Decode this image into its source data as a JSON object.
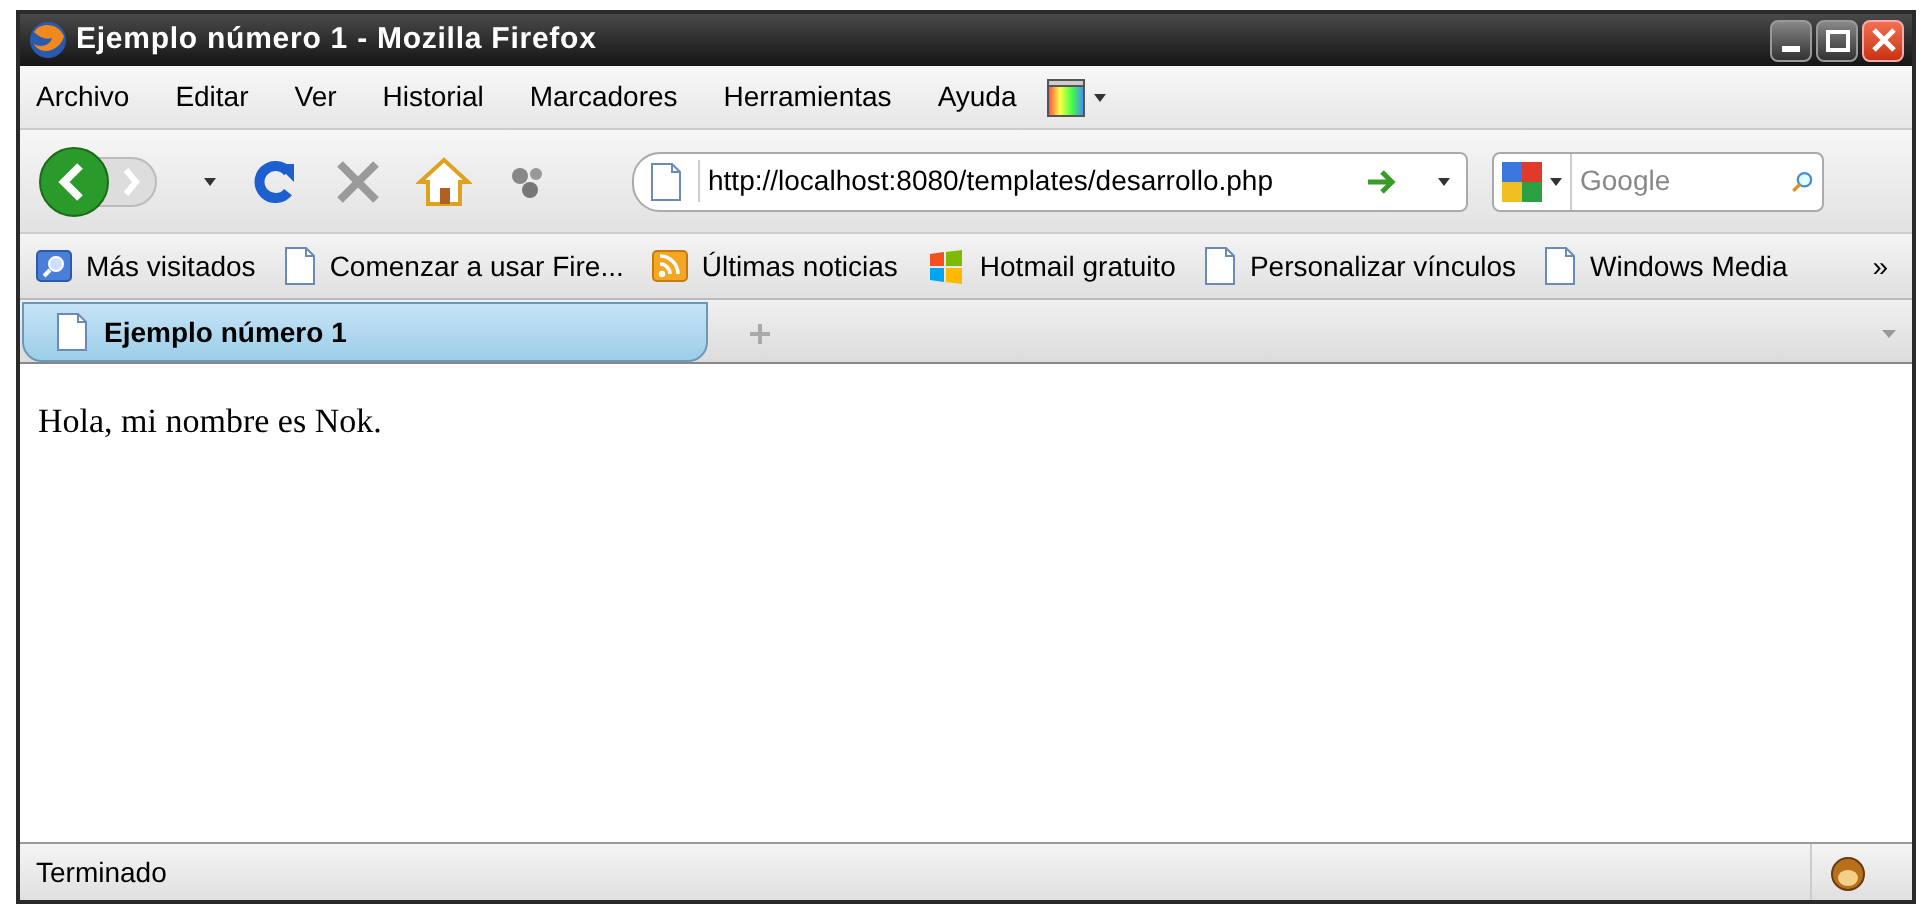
{
  "window": {
    "title": "Ejemplo número 1 - Mozilla Firefox"
  },
  "menu": [
    "Archivo",
    "Editar",
    "Ver",
    "Historial",
    "Marcadores",
    "Herramientas",
    "Ayuda"
  ],
  "address": {
    "value": "http://localhost:8080/templates/desarrollo.php"
  },
  "search": {
    "placeholder": "Google"
  },
  "bookmarks": [
    {
      "label": "Más visitados",
      "kind": "search"
    },
    {
      "label": "Comenzar a usar Fire...",
      "kind": "page"
    },
    {
      "label": "Últimas noticias",
      "kind": "feed"
    },
    {
      "label": "Hotmail gratuito",
      "kind": "flag"
    },
    {
      "label": "Personalizar vínculos",
      "kind": "page"
    },
    {
      "label": "Windows Media",
      "kind": "page"
    }
  ],
  "bookmarks_overflow": "»",
  "tabs": [
    {
      "label": "Ejemplo número 1",
      "selected": true
    }
  ],
  "page": {
    "text": "Hola, mi nombre es Nok."
  },
  "status_bar": {
    "text": "Terminado"
  }
}
